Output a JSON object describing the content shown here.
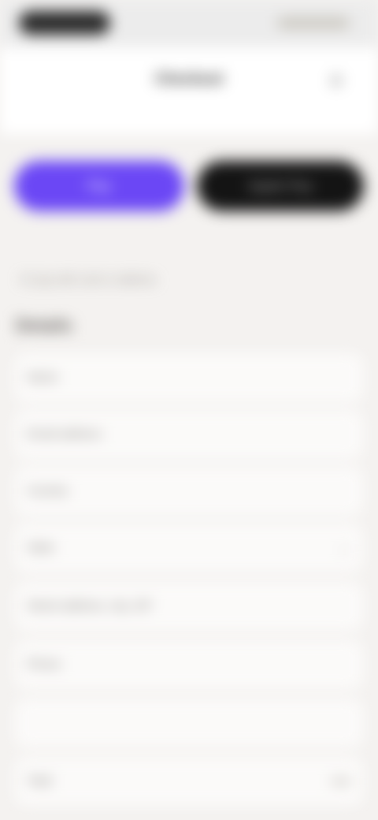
{
  "header": {
    "title": "Checkout",
    "settings_icon": "gear-icon"
  },
  "actions": {
    "primary_label": "Pay",
    "secondary_label": "Apple Pay"
  },
  "note": "Or pay with card or address",
  "section": {
    "title": "Details"
  },
  "rows": [
    {
      "label": "Name"
    },
    {
      "label": "Email address"
    },
    {
      "label": "Country"
    },
    {
      "label": "State"
    },
    {
      "label": "Street address, city, ZIP"
    },
    {
      "label": "Phone"
    },
    {
      "label": ""
    },
    {
      "label": "Total"
    }
  ],
  "colors": {
    "accent": "#6b47f5",
    "dark_button": "#141414",
    "background": "#f4f2f0"
  }
}
